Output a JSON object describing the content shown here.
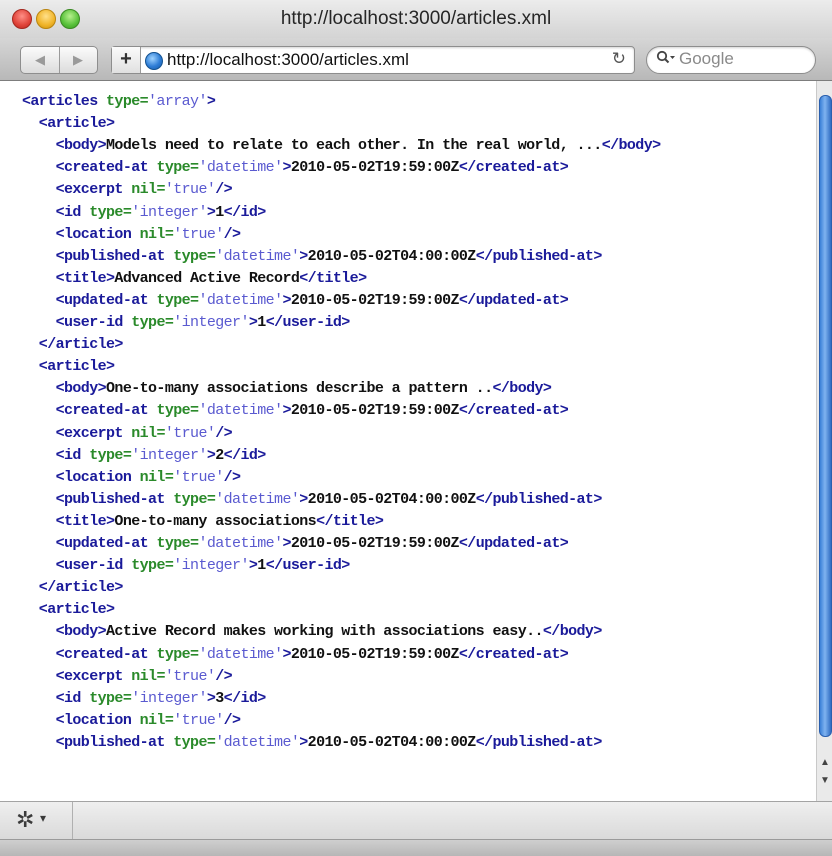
{
  "window": {
    "title": "http://localhost:3000/articles.xml"
  },
  "toolbar": {
    "back_glyph": "◀",
    "forward_glyph": "▶",
    "add_glyph": "+",
    "url": "http://localhost:3000/articles.xml",
    "reload_glyph": "↻",
    "search_placeholder": "Google"
  },
  "xml_lines": [
    [
      [
        "tag",
        "<articles "
      ],
      [
        "attr",
        "type="
      ],
      [
        "val",
        "'array'"
      ],
      [
        "tag",
        ">"
      ]
    ],
    [
      [
        "tag",
        "  <article>"
      ]
    ],
    [
      [
        "tag",
        "    <body>"
      ],
      [
        "txt",
        "Models need to relate to each other. In the real world, ..."
      ],
      [
        "tag",
        "</body>"
      ]
    ],
    [
      [
        "tag",
        "    <created-at "
      ],
      [
        "attr",
        "type="
      ],
      [
        "val",
        "'datetime'"
      ],
      [
        "tag",
        ">"
      ],
      [
        "txt",
        "2010-05-02T19:59:00Z"
      ],
      [
        "tag",
        "</created-at>"
      ]
    ],
    [
      [
        "tag",
        "    <excerpt "
      ],
      [
        "attr",
        "nil="
      ],
      [
        "val",
        "'true'"
      ],
      [
        "tag",
        "/>"
      ]
    ],
    [
      [
        "tag",
        "    <id "
      ],
      [
        "attr",
        "type="
      ],
      [
        "val",
        "'integer'"
      ],
      [
        "tag",
        ">"
      ],
      [
        "txt",
        "1"
      ],
      [
        "tag",
        "</id>"
      ]
    ],
    [
      [
        "tag",
        "    <location "
      ],
      [
        "attr",
        "nil="
      ],
      [
        "val",
        "'true'"
      ],
      [
        "tag",
        "/>"
      ]
    ],
    [
      [
        "tag",
        "    <published-at "
      ],
      [
        "attr",
        "type="
      ],
      [
        "val",
        "'datetime'"
      ],
      [
        "tag",
        ">"
      ],
      [
        "txt",
        "2010-05-02T04:00:00Z"
      ],
      [
        "tag",
        "</published-at>"
      ]
    ],
    [
      [
        "tag",
        "    <title>"
      ],
      [
        "txt",
        "Advanced Active Record"
      ],
      [
        "tag",
        "</title>"
      ]
    ],
    [
      [
        "tag",
        "    <updated-at "
      ],
      [
        "attr",
        "type="
      ],
      [
        "val",
        "'datetime'"
      ],
      [
        "tag",
        ">"
      ],
      [
        "txt",
        "2010-05-02T19:59:00Z"
      ],
      [
        "tag",
        "</updated-at>"
      ]
    ],
    [
      [
        "tag",
        "    <user-id "
      ],
      [
        "attr",
        "type="
      ],
      [
        "val",
        "'integer'"
      ],
      [
        "tag",
        ">"
      ],
      [
        "txt",
        "1"
      ],
      [
        "tag",
        "</user-id>"
      ]
    ],
    [
      [
        "tag",
        "  </article>"
      ]
    ],
    [
      [
        "tag",
        "  <article>"
      ]
    ],
    [
      [
        "tag",
        "    <body>"
      ],
      [
        "txt",
        "One-to-many associations describe a pattern .."
      ],
      [
        "tag",
        "</body>"
      ]
    ],
    [
      [
        "tag",
        "    <created-at "
      ],
      [
        "attr",
        "type="
      ],
      [
        "val",
        "'datetime'"
      ],
      [
        "tag",
        ">"
      ],
      [
        "txt",
        "2010-05-02T19:59:00Z"
      ],
      [
        "tag",
        "</created-at>"
      ]
    ],
    [
      [
        "tag",
        "    <excerpt "
      ],
      [
        "attr",
        "nil="
      ],
      [
        "val",
        "'true'"
      ],
      [
        "tag",
        "/>"
      ]
    ],
    [
      [
        "tag",
        "    <id "
      ],
      [
        "attr",
        "type="
      ],
      [
        "val",
        "'integer'"
      ],
      [
        "tag",
        ">"
      ],
      [
        "txt",
        "2"
      ],
      [
        "tag",
        "</id>"
      ]
    ],
    [
      [
        "tag",
        "    <location "
      ],
      [
        "attr",
        "nil="
      ],
      [
        "val",
        "'true'"
      ],
      [
        "tag",
        "/>"
      ]
    ],
    [
      [
        "tag",
        "    <published-at "
      ],
      [
        "attr",
        "type="
      ],
      [
        "val",
        "'datetime'"
      ],
      [
        "tag",
        ">"
      ],
      [
        "txt",
        "2010-05-02T04:00:00Z"
      ],
      [
        "tag",
        "</published-at>"
      ]
    ],
    [
      [
        "tag",
        "    <title>"
      ],
      [
        "txt",
        "One-to-many associations"
      ],
      [
        "tag",
        "</title>"
      ]
    ],
    [
      [
        "tag",
        "    <updated-at "
      ],
      [
        "attr",
        "type="
      ],
      [
        "val",
        "'datetime'"
      ],
      [
        "tag",
        ">"
      ],
      [
        "txt",
        "2010-05-02T19:59:00Z"
      ],
      [
        "tag",
        "</updated-at>"
      ]
    ],
    [
      [
        "tag",
        "    <user-id "
      ],
      [
        "attr",
        "type="
      ],
      [
        "val",
        "'integer'"
      ],
      [
        "tag",
        ">"
      ],
      [
        "txt",
        "1"
      ],
      [
        "tag",
        "</user-id>"
      ]
    ],
    [
      [
        "tag",
        "  </article>"
      ]
    ],
    [
      [
        "tag",
        "  <article>"
      ]
    ],
    [
      [
        "tag",
        "    <body>"
      ],
      [
        "txt",
        "Active Record makes working with associations easy.."
      ],
      [
        "tag",
        "</body>"
      ]
    ],
    [
      [
        "tag",
        "    <created-at "
      ],
      [
        "attr",
        "type="
      ],
      [
        "val",
        "'datetime'"
      ],
      [
        "tag",
        ">"
      ],
      [
        "txt",
        "2010-05-02T19:59:00Z"
      ],
      [
        "tag",
        "</created-at>"
      ]
    ],
    [
      [
        "tag",
        "    <excerpt "
      ],
      [
        "attr",
        "nil="
      ],
      [
        "val",
        "'true'"
      ],
      [
        "tag",
        "/>"
      ]
    ],
    [
      [
        "tag",
        "    <id "
      ],
      [
        "attr",
        "type="
      ],
      [
        "val",
        "'integer'"
      ],
      [
        "tag",
        ">"
      ],
      [
        "txt",
        "3"
      ],
      [
        "tag",
        "</id>"
      ]
    ],
    [
      [
        "tag",
        "    <location "
      ],
      [
        "attr",
        "nil="
      ],
      [
        "val",
        "'true'"
      ],
      [
        "tag",
        "/>"
      ]
    ],
    [
      [
        "tag",
        "    <published-at "
      ],
      [
        "attr",
        "type="
      ],
      [
        "val",
        "'datetime'"
      ],
      [
        "tag",
        ">"
      ],
      [
        "txt",
        "2010-05-02T04:00:00Z"
      ],
      [
        "tag",
        "</published-at>"
      ]
    ]
  ],
  "bottom_bar": {
    "gear_glyph": "✲",
    "arrow_glyph": "▾"
  }
}
